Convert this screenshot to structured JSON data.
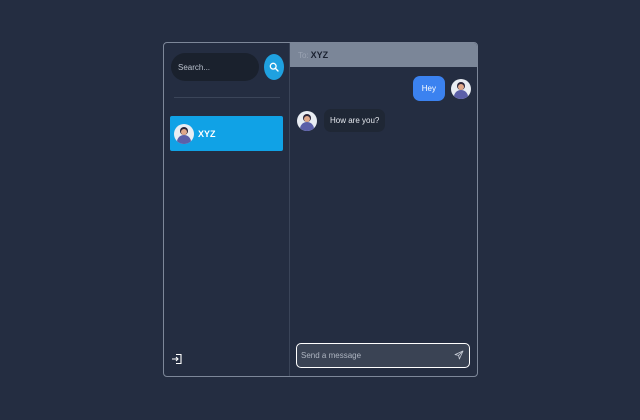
{
  "sidebar": {
    "search": {
      "placeholder": "Search...",
      "button_icon": "search-icon"
    },
    "contacts": [
      {
        "name": "XYZ",
        "selected": true
      }
    ],
    "logout_icon": "logout-icon"
  },
  "chat": {
    "header": {
      "prefix": "To:",
      "name": "XYZ"
    },
    "messages": [
      {
        "direction": "sent",
        "text": "Hey"
      },
      {
        "direction": "received",
        "text": "How are you?"
      }
    ],
    "composer": {
      "placeholder": "Send a message",
      "send_icon": "send-icon"
    }
  },
  "colors": {
    "background": "#242d41",
    "accent": "#1fa1e0",
    "selected_contact": "#10a2e6",
    "sent_bubble": "#3b82f0",
    "received_bubble": "#1f2735",
    "header": "#7b8698"
  }
}
